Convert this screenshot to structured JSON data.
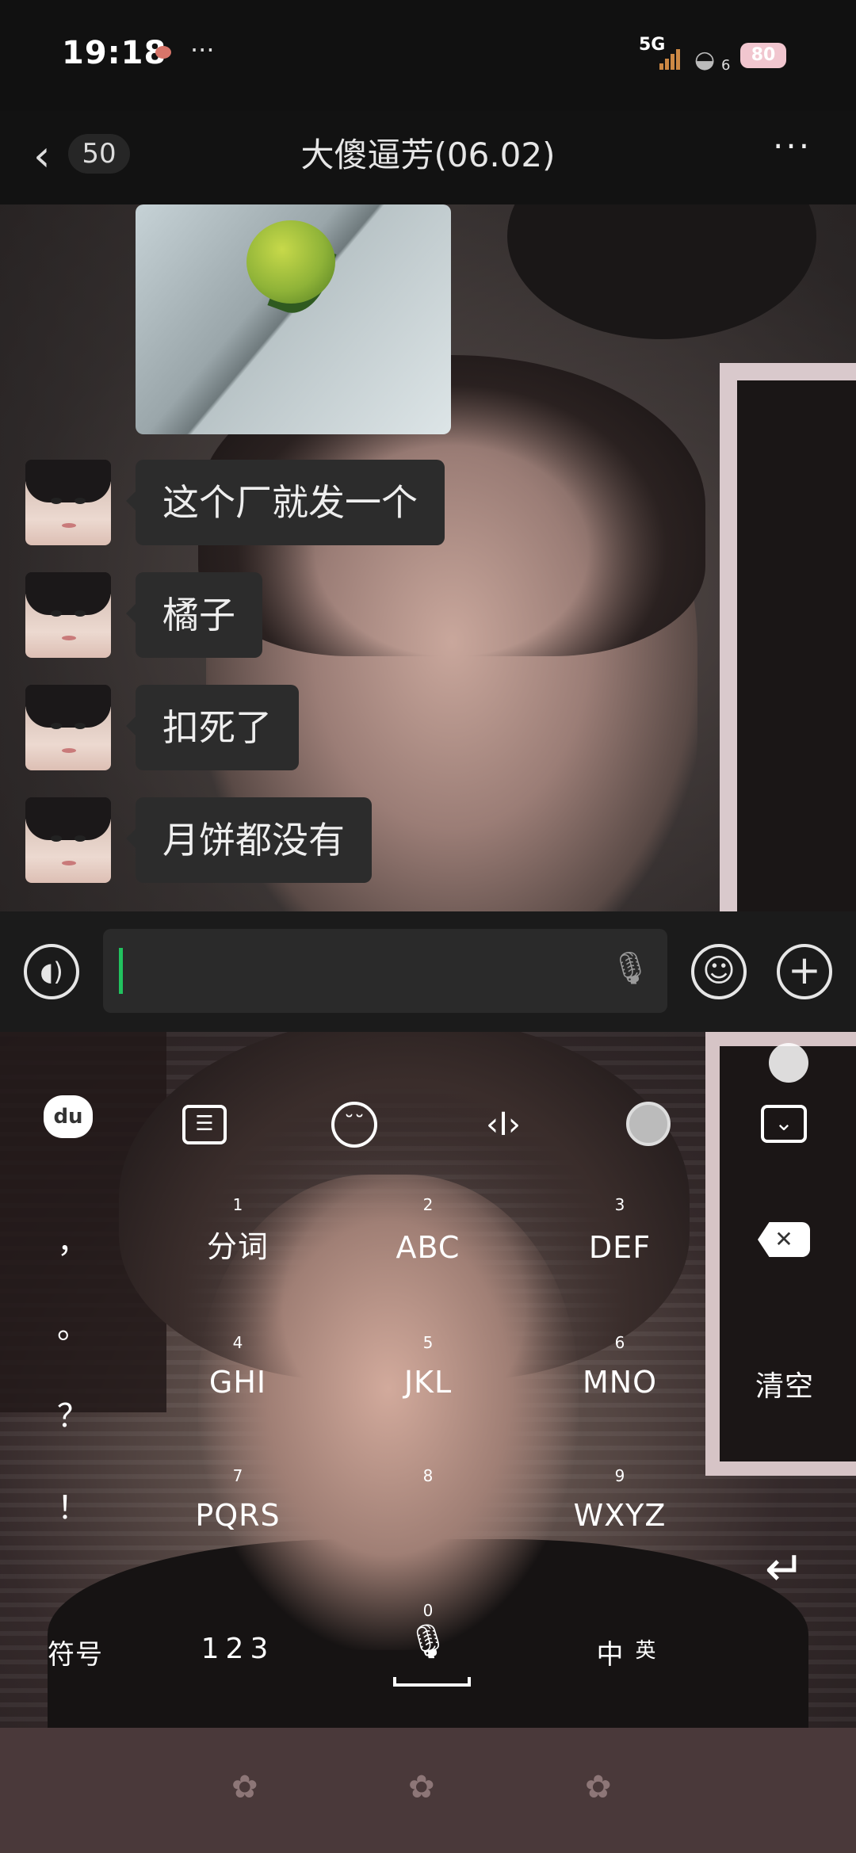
{
  "status_bar": {
    "time": "19:18",
    "more": "···",
    "network": "5G",
    "wifi_level": "6",
    "battery": "80"
  },
  "header": {
    "back_icon": "‹",
    "unread_count": "50",
    "title": "大傻逼芳(06.02)",
    "more_icon": "···"
  },
  "messages": [
    {
      "text": "这个厂就发一个"
    },
    {
      "text": "橘子"
    },
    {
      "text": "扣死了"
    },
    {
      "text": "月饼都没有"
    }
  ],
  "input": {
    "value": ""
  },
  "keyboard": {
    "toolbar": {
      "logo": "du"
    },
    "punctuation": [
      "，",
      "。",
      "？",
      "！"
    ],
    "keys": [
      {
        "num": "1",
        "label": "分词"
      },
      {
        "num": "2",
        "label": "ABC"
      },
      {
        "num": "3",
        "label": "DEF"
      },
      {
        "num": "4",
        "label": "GHI"
      },
      {
        "num": "5",
        "label": "JKL"
      },
      {
        "num": "6",
        "label": "MNO"
      },
      {
        "num": "7",
        "label": "PQRS"
      },
      {
        "num": "8",
        "label": ""
      },
      {
        "num": "9",
        "label": "WXYZ"
      }
    ],
    "clear_label": "清空",
    "symbols_label": "符号",
    "numbers_label": "123",
    "zero_num": "0",
    "lang_label": "中",
    "lang_sub": "英"
  },
  "colors": {
    "caret": "#21c25e",
    "bubble": "#2c2c2c",
    "nav": "#4a393a"
  }
}
